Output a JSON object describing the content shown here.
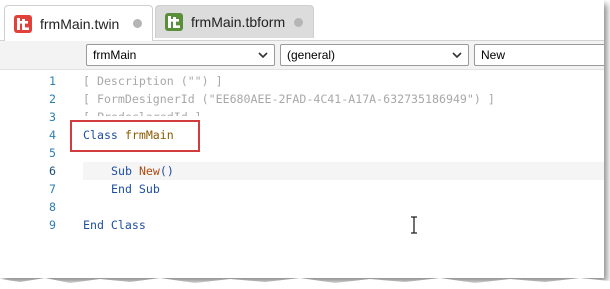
{
  "tabs": [
    {
      "label": "frmMain.twin",
      "icon": "twinbasic-red-icon",
      "color": "#e0423a",
      "active": true
    },
    {
      "label": "frmMain.tbform",
      "icon": "twinbasic-green-icon",
      "color": "#5a8f3a",
      "active": false
    }
  ],
  "toolbar": {
    "object_select": "frmMain",
    "procedure_select": "(general)",
    "action_select": "New"
  },
  "editor": {
    "lines": [
      {
        "num": "1",
        "text": "[ Description (\"\") ]"
      },
      {
        "num": "2",
        "text": "[ FormDesignerId (\"EE680AEE-2FAD-4C41-A17A-632735186949\") ]"
      },
      {
        "num": "3",
        "text": "[ PredeclaredId ]"
      },
      {
        "num": "4",
        "kw": "Class",
        "ident": "frmMain"
      },
      {
        "num": "5"
      },
      {
        "num": "6",
        "kw": "Sub",
        "fn": "New",
        "rest": "()"
      },
      {
        "num": "7",
        "text": "End Sub"
      },
      {
        "num": "8"
      },
      {
        "num": "9",
        "text": "End Class"
      }
    ]
  },
  "colors": {
    "highlight_box": "#d23c3c",
    "keyword": "#1f4fa0",
    "identifier": "#8b5a00",
    "line_number": "#2b7fb3"
  }
}
